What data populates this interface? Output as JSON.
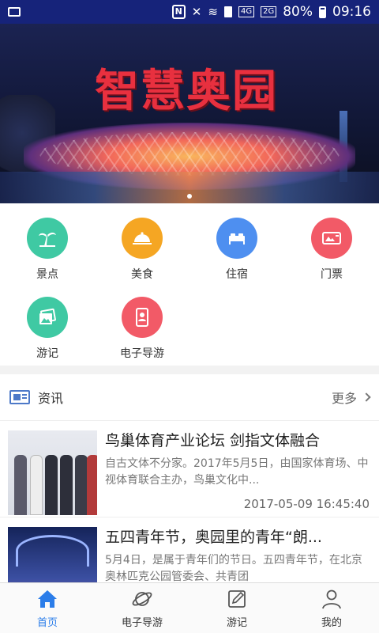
{
  "status_bar": {
    "battery": "80%",
    "time": "09:16",
    "network_labels": [
      "4G",
      "2G"
    ]
  },
  "banner": {
    "title": "智慧奥园"
  },
  "categories": [
    {
      "label": "景点",
      "color": "#3fc9a3",
      "icon": "palm-tree-icon"
    },
    {
      "label": "美食",
      "color": "#f5a623",
      "icon": "food-dish-icon"
    },
    {
      "label": "住宿",
      "color": "#4e8ff0",
      "icon": "bed-icon"
    },
    {
      "label": "门票",
      "color": "#f25a67",
      "icon": "ticket-icon"
    },
    {
      "label": "游记",
      "color": "#3fc9a3",
      "icon": "photo-notes-icon"
    },
    {
      "label": "电子导游",
      "color": "#f25a67",
      "icon": "guide-device-icon"
    }
  ],
  "news_section": {
    "title": "资讯",
    "more": "更多"
  },
  "news": [
    {
      "title": "鸟巢体育产业论坛 剑指文体融合",
      "summary": "自古文体不分家。2017年5月5日，由国家体育场、中视体育联合主办，鸟巢文化中...",
      "date": "2017-05-09 16:45:40"
    },
    {
      "title": "五四青年节，奥园里的青年“朗...",
      "summary": "5月4日，是属于青年们的节日。五四青年节，在北京奥林匹克公园管委会、共青团",
      "date": ""
    }
  ],
  "tabs": [
    {
      "label": "首页",
      "icon": "home-icon",
      "active": true
    },
    {
      "label": "电子导游",
      "icon": "planet-icon",
      "active": false
    },
    {
      "label": "游记",
      "icon": "edit-note-icon",
      "active": false
    },
    {
      "label": "我的",
      "icon": "user-icon",
      "active": false
    }
  ],
  "colors": {
    "status_bar": "#16237a",
    "accent": "#2b7de9"
  }
}
